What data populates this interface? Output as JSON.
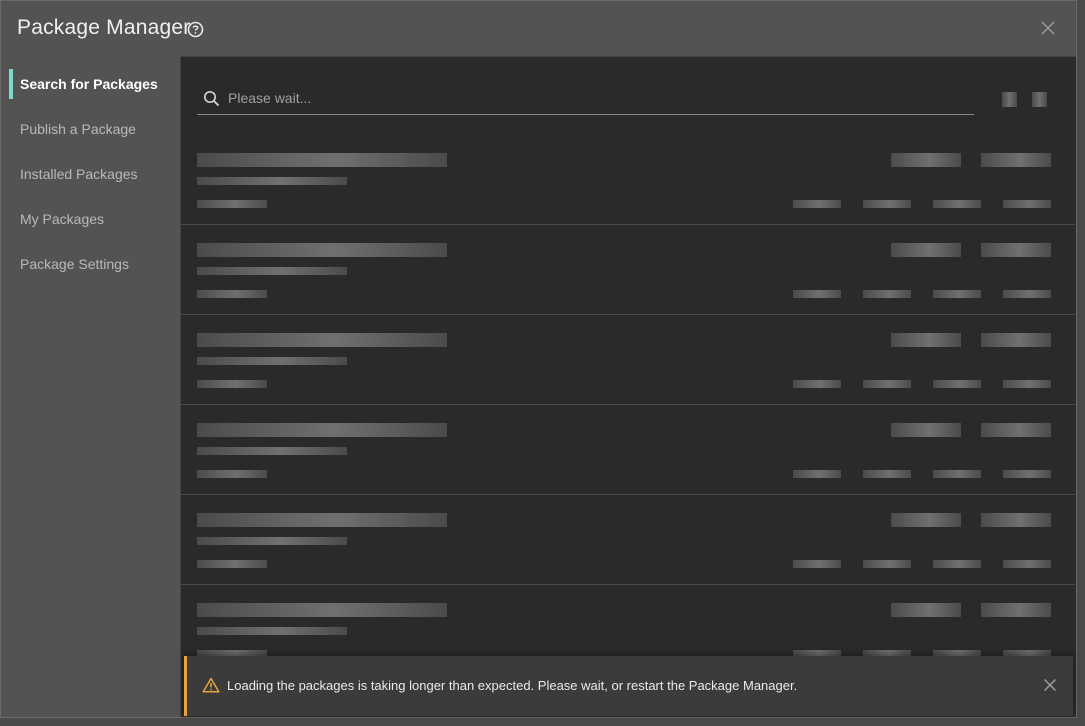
{
  "window": {
    "title": "Package Manager"
  },
  "sidebar": {
    "items": [
      {
        "label": "Search for Packages",
        "active": true
      },
      {
        "label": "Publish a Package",
        "active": false
      },
      {
        "label": "Installed Packages",
        "active": false
      },
      {
        "label": "My Packages",
        "active": false
      },
      {
        "label": "Package Settings",
        "active": false
      }
    ]
  },
  "search": {
    "placeholder": "Please wait..."
  },
  "toast": {
    "message": "Loading the packages is taking longer than expected. Please wait, or restart the Package Manager."
  },
  "colors": {
    "accent": "#7fd6cf",
    "warning": "#e8a33d"
  },
  "icons": [
    "help-icon",
    "close-icon",
    "search-icon",
    "warning-icon"
  ]
}
